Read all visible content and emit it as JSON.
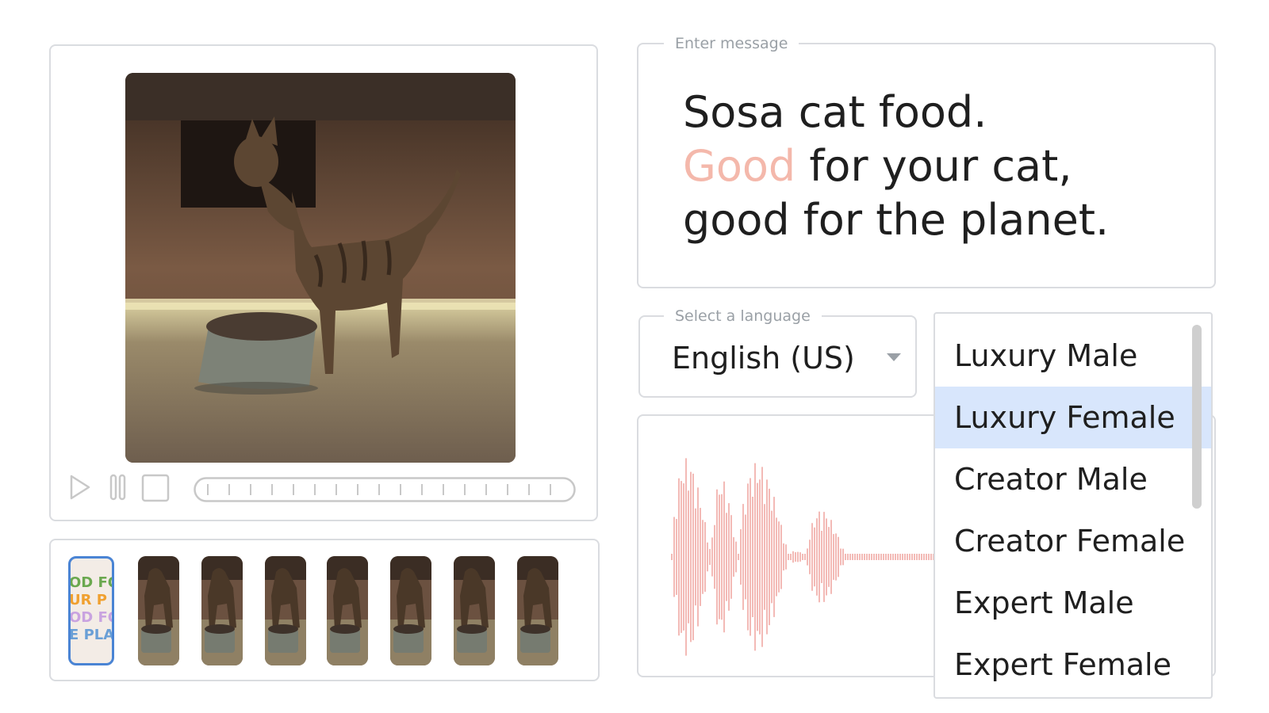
{
  "message": {
    "legend": "Enter message",
    "line1": "Sosa cat food.",
    "line2_highlight": "Good",
    "line2_rest": " for your cat,",
    "line3": "good for the planet."
  },
  "language": {
    "legend": "Select a language",
    "value": "English (US)"
  },
  "voices": {
    "items": [
      "Luxury Male",
      "Luxury Female",
      "Creator Male",
      "Creator Female",
      "Expert Male",
      "Expert Female"
    ],
    "selected": "Luxury Female"
  },
  "filmstrip": {
    "text_thumb_lines": [
      "OD FO",
      "UR P",
      "OD FO",
      "E PLA"
    ],
    "text_thumb_colors": [
      "#6aa84f",
      "#f0a030",
      "#c9a3e0",
      "#6a9fd6"
    ]
  },
  "colors": {
    "border": "#dadce0",
    "highlight_text": "#f4b8ab",
    "selected_bg": "#d8e6fc",
    "waveform": "#f0a8a4"
  },
  "icons": [
    "play-icon",
    "pause-icon",
    "stop-icon",
    "dropdown-arrow-icon"
  ]
}
